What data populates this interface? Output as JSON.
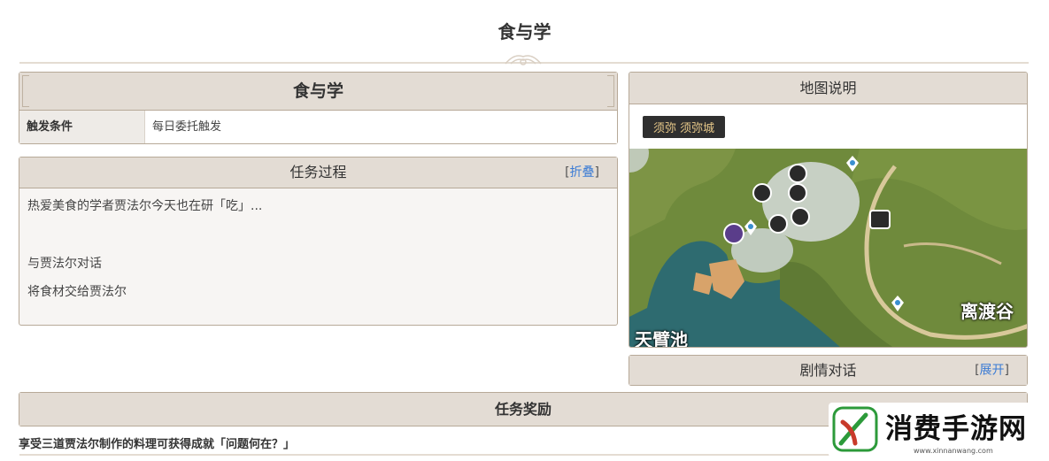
{
  "page": {
    "title": "食与学"
  },
  "quest_info": {
    "name": "食与学",
    "trigger_label": "触发条件",
    "trigger_value": "每日委托触发"
  },
  "process": {
    "title": "任务过程",
    "toggle_open": "[",
    "toggle_label": "折叠",
    "toggle_close": "]",
    "lines": [
      "热爱美食的学者贾法尔今天也在研「吃」...",
      "",
      "",
      "与贾法尔对话",
      "",
      "将食材交给贾法尔"
    ]
  },
  "map": {
    "title": "地图说明",
    "tag": "须弥 须弥城",
    "labels": {
      "left": "天臂池",
      "right": "离渡谷"
    }
  },
  "dialog": {
    "title": "剧情对话",
    "toggle_open": "[",
    "toggle_label": "展开",
    "toggle_close": "]"
  },
  "reward": {
    "title": "任务奖励",
    "text": "享受三道贾法尔制作的料理可获得成就「问题何在？」"
  },
  "watermark": {
    "text": "消费手游网",
    "url": "www.xinnanwang.com"
  },
  "colors": {
    "panel_header": "#e3dcd4",
    "panel_border": "#b7a998",
    "link": "#3a7bd5",
    "tag_bg": "#2f2f2f",
    "tag_text": "#e8c98a",
    "map_water": "#2e6b70",
    "map_land": "#6f8a3c"
  }
}
